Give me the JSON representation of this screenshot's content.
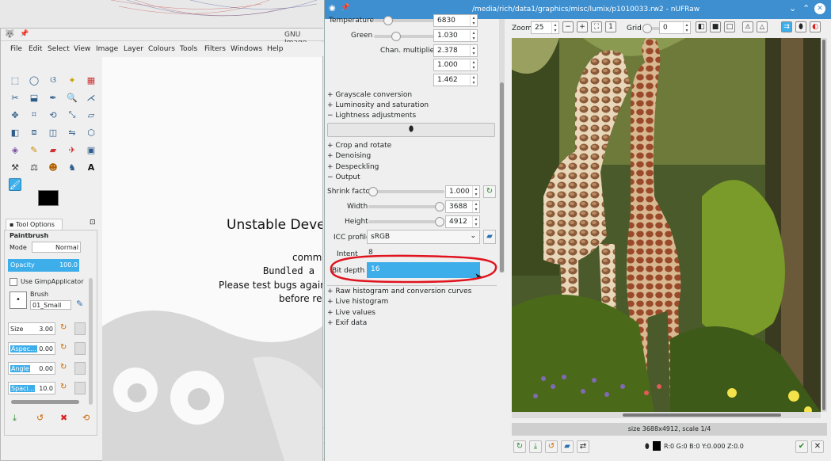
{
  "gimp": {
    "title": "GNU Image",
    "menu": [
      "File",
      "Edit",
      "Select",
      "View",
      "Image",
      "Layer",
      "Colours",
      "Tools",
      "Filters",
      "Windows",
      "Help"
    ],
    "tool_options_tab": "Tool Options",
    "paintbrush": "Paintbrush",
    "mode_label": "Mode",
    "mode_value": "Normal",
    "opacity_label": "Opacity",
    "opacity_value": "100.0",
    "use_gimp_applicator": "Use GimpApplicator",
    "brush_label": "Brush",
    "brush_value": "01_Small",
    "size_label": "Size",
    "size_value": "3.00",
    "aspect_label": "Aspec...",
    "aspect_value": "0.00",
    "angle_label": "Angle",
    "angle_value": "0.00",
    "spacing_label": "Spaci...",
    "spacing_value": "10.0",
    "canvas_lines": [
      "Unstable Deve",
      "comm",
      "Bundled a",
      "Please test bugs again",
      "before re"
    ]
  },
  "ufraw": {
    "title": "/media/rich/data1/graphics/misc/lumix/p1010033.rw2 - nUFRaw",
    "temperature_label": "Temperature",
    "temperature_value": "6830",
    "green_label": "Green",
    "green_value": "1.030",
    "chan_label": "Chan. multipliers",
    "chan_values": [
      "2.378",
      "1.000",
      "1.462"
    ],
    "sections": [
      "Grayscale conversion",
      "Luminosity and saturation",
      "Lightness adjustments",
      "Crop and rotate",
      "Denoising",
      "Despeckling",
      "Output"
    ],
    "shrink_label": "Shrink factor",
    "shrink_value": "1.000",
    "width_label": "Width",
    "width_value": "3688",
    "height_label": "Height",
    "height_value": "4912",
    "icc_label": "ICC profile",
    "icc_value": "sRGB",
    "intent_label": "Intent",
    "intent_value": "8",
    "bitdepth_label": "Bit depth",
    "bitdepth_value": "16",
    "lower_sections": [
      "Raw histogram and conversion curves",
      "Live histogram",
      "Live values",
      "Exif data"
    ],
    "zoom_label": "Zoom",
    "zoom_value": "25",
    "grid_label": "Grid",
    "grid_value": "0",
    "status": "size 3688x4912, scale 1/4",
    "values_readout": "R:0 G:0 B:0 Y:0.000 Z:0.0"
  },
  "colors": {
    "titlebar": "#3d8fd0",
    "selection": "#3daee9",
    "annotation": "#e0141e"
  }
}
